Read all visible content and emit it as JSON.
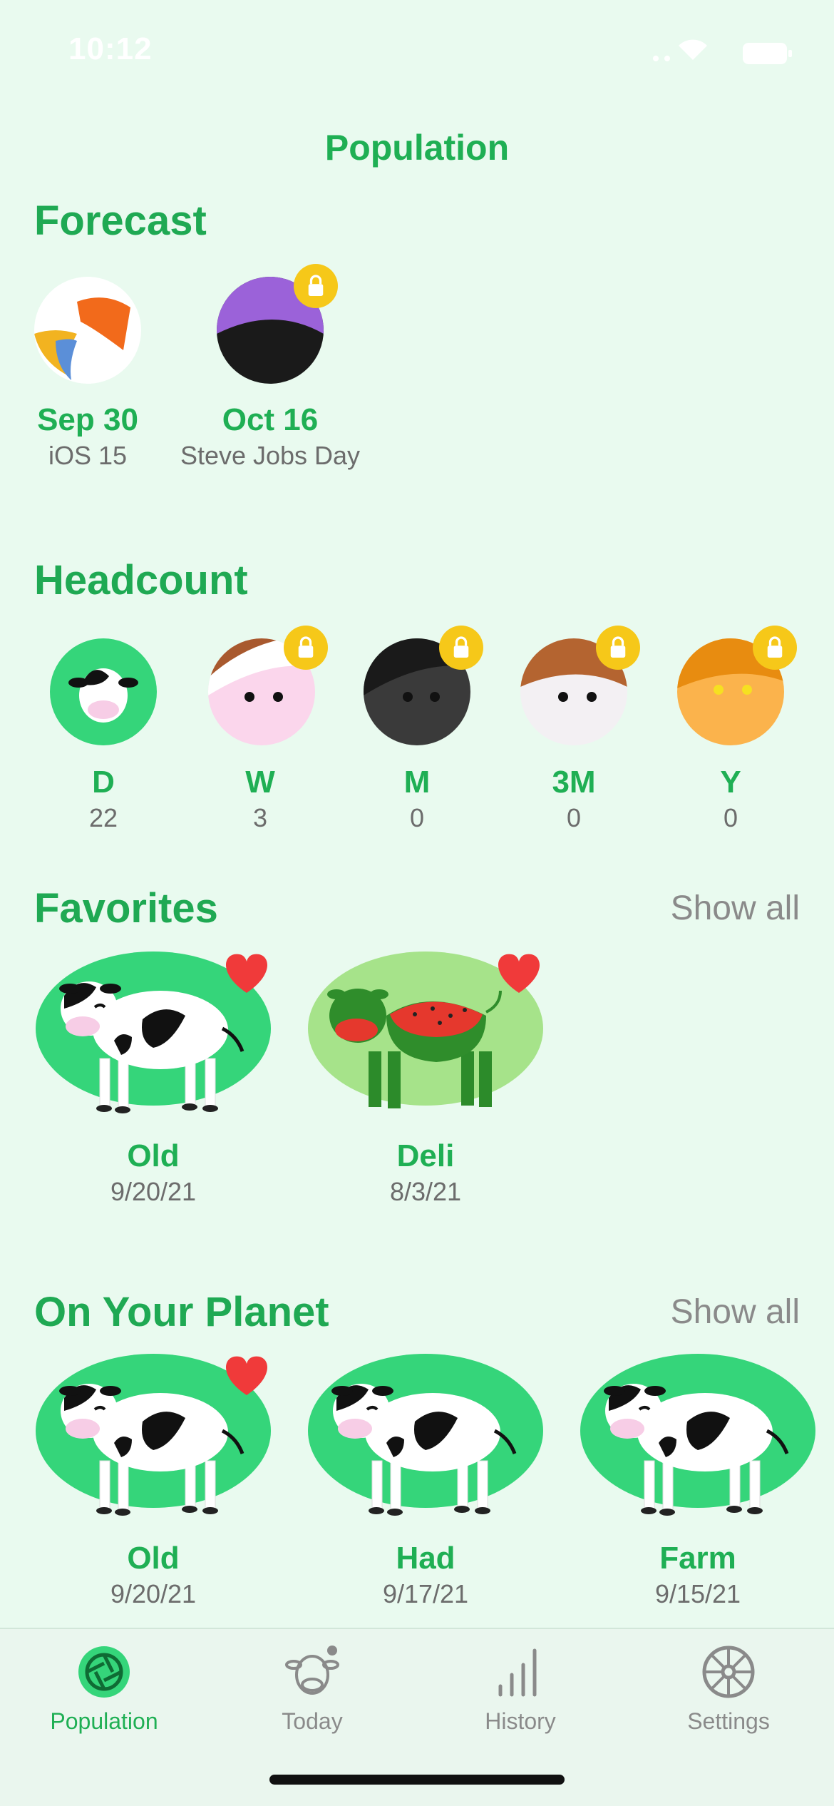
{
  "status": {
    "time": "10:12"
  },
  "nav": {
    "title": "Population"
  },
  "forecast": {
    "title": "Forecast",
    "items": [
      {
        "label": "Sep 30",
        "sub": "iOS 15",
        "locked": false
      },
      {
        "label": "Oct 16",
        "sub": "Steve Jobs Day",
        "locked": true
      }
    ]
  },
  "headcount": {
    "title": "Headcount",
    "items": [
      {
        "label": "D",
        "count": "22",
        "locked": false
      },
      {
        "label": "W",
        "count": "3",
        "locked": true
      },
      {
        "label": "M",
        "count": "0",
        "locked": true
      },
      {
        "label": "3M",
        "count": "0",
        "locked": true
      },
      {
        "label": "Y",
        "count": "0",
        "locked": true
      }
    ]
  },
  "favorites": {
    "title": "Favorites",
    "show_all": "Show all",
    "items": [
      {
        "label": "Old",
        "date": "9/20/21",
        "favorite": true
      },
      {
        "label": "Deli",
        "date": "8/3/21",
        "favorite": true
      }
    ]
  },
  "planet": {
    "title": "On Your Planet",
    "show_all": "Show all",
    "items": [
      {
        "label": "Old",
        "date": "9/20/21",
        "favorite": true
      },
      {
        "label": "Had",
        "date": "9/17/21",
        "favorite": false
      },
      {
        "label": "Farm",
        "date": "9/15/21",
        "favorite": false
      }
    ]
  },
  "tabs": [
    {
      "label": "Population",
      "icon": "aperture-icon",
      "active": true
    },
    {
      "label": "Today",
      "icon": "cow-face-icon",
      "active": false
    },
    {
      "label": "History",
      "icon": "bar-chart-icon",
      "active": false
    },
    {
      "label": "Settings",
      "icon": "wheel-icon",
      "active": false
    }
  ],
  "colors": {
    "accent": "#1faf54",
    "background": "#e9faef",
    "lock": "#f6c819",
    "heart": "#f03a3a"
  }
}
